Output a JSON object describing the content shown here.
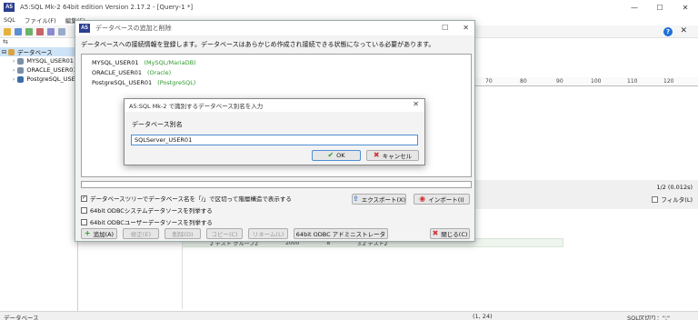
{
  "window": {
    "app_icon_text": "A5",
    "title": "A5:SQL Mk-2 64bit edition Version 2.17.2 - [Query-1 *]",
    "min": "—",
    "max": "☐",
    "close": "✕"
  },
  "menubar": {
    "items": [
      "SQL",
      "ファイル(F)",
      "編集(E)"
    ]
  },
  "toolbar": {
    "help": "?",
    "close": "✕"
  },
  "tree": {
    "header": "⇆",
    "root": "データベース",
    "items": [
      "MYSQL_USER01",
      "ORACLE_USER01",
      "PostgreSQL_USE"
    ]
  },
  "ruler": {
    "ticks": [
      "70",
      "80",
      "90",
      "100",
      "110",
      "120"
    ]
  },
  "results": {
    "count": "1/2 (0.012s)",
    "filter": "フィルタ(L)",
    "ghost_row": [
      "2  テスト グループ2",
      "2000",
      "8",
      "3.2  テスト2"
    ]
  },
  "statusbar": {
    "left": "データベース",
    "middle": "(1, 24)",
    "right": "SQL区切り：\";\""
  },
  "dialog": {
    "icon_text": "A5",
    "title": "データベースの追加と削除",
    "description": "データベースへの接続情報を登録します。データベースはあらかじめ作成され接続できる状態になっている必要があります。",
    "connections": [
      {
        "name": "MYSQL_USER01",
        "type": "(MySQL/MariaDB)"
      },
      {
        "name": "ORACLE_USER01",
        "type": "(Oracle)"
      },
      {
        "name": "PostgreSQL_USER01",
        "type": "(PostgreSQL)"
      }
    ],
    "options": [
      {
        "label": "データベースツリーでデータベース名を「/」で区切って階層構造で表示する",
        "checked": true
      },
      {
        "label": "64bit ODBCシステムデータソースを列挙する",
        "checked": false
      },
      {
        "label": "64bit ODBCユーザーデータソースを列挙する",
        "checked": false
      }
    ],
    "buttons": {
      "export": "エクスポート(X)",
      "import": "インポート(I)",
      "add": "追加(A)",
      "edit": "修正(E)",
      "delete": "削除(D)",
      "copy": "コピー(C)",
      "link": "リネーム(L)",
      "odbc_admin": "64bit ODBC アドミニストレータ",
      "close": "閉じる(C)"
    }
  },
  "alias_dialog": {
    "title": "A5:SQL Mk-2 で識別するデータベース別名を入力",
    "label": "データベース別名",
    "value": "SQLServer_USER01",
    "ok": "OK",
    "cancel": "キャンセル"
  },
  "colors": {
    "accent": "#1e6fd9",
    "type_green": "#2e9a2e",
    "ok_green": "#2e9a2e",
    "cancel_red": "#d13434",
    "selection": "#cde3f7"
  }
}
